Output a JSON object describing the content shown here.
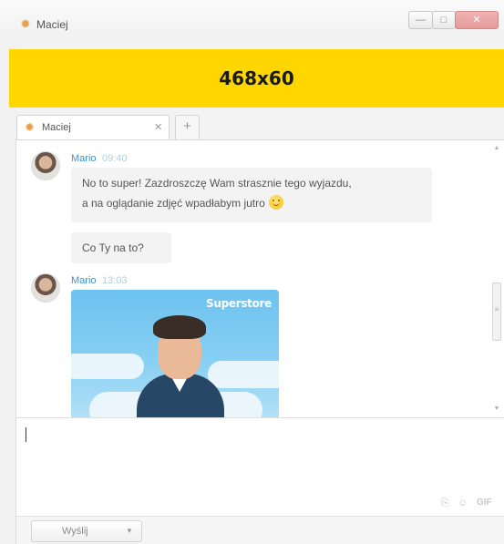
{
  "window": {
    "title": "Maciej",
    "minimize_glyph": "—",
    "maximize_glyph": "□",
    "close_glyph": "✕"
  },
  "ad": {
    "label": "468x60",
    "color": "#ffd600"
  },
  "tabs": [
    {
      "label": "Maciej",
      "close_glyph": "✕"
    }
  ],
  "tab_add_glyph": "+",
  "messages": [
    {
      "author": "Mario",
      "time": "09:40",
      "bubbles": [
        {
          "line1": "No to super! Zazdroszczę Wam strasznie tego wyjazdu,",
          "line2": "a na oglądanie zdjęć wpadłabym jutro",
          "emoji": "smile-emoji"
        },
        {
          "line1": "Co Ty na to?"
        }
      ]
    },
    {
      "author": "Mario",
      "time": "13:03",
      "image": {
        "brand": "Superstore",
        "subject": "man-photo"
      }
    }
  ],
  "scroll": {
    "up_glyph": "▲",
    "down_glyph": "▼",
    "grip_glyph": "≡"
  },
  "input": {
    "value": "",
    "placeholder": ""
  },
  "toolbar": {
    "attach_glyph": "⎘",
    "emoji_glyph": "☺",
    "gif_label": "GIF"
  },
  "send": {
    "label": "Wyślij",
    "arrow_glyph": "▼"
  },
  "colors": {
    "link_name": "#3f8fd2",
    "time": "#b3cde0",
    "bubble_bg": "#f3f3f3",
    "window_bg": "#f3f3f3"
  }
}
